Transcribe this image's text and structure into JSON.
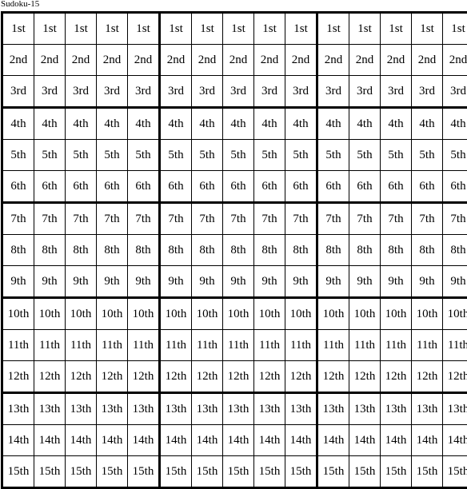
{
  "title": "Sudoku-15",
  "grid": {
    "rows": 15,
    "cols": 15,
    "box_rows": 3,
    "box_cols": 5,
    "row_labels": [
      "1st",
      "2nd",
      "3rd",
      "4th",
      "5th",
      "6th",
      "7th",
      "8th",
      "9th",
      "10th",
      "11th",
      "12th",
      "13th",
      "14th",
      "15th"
    ]
  }
}
